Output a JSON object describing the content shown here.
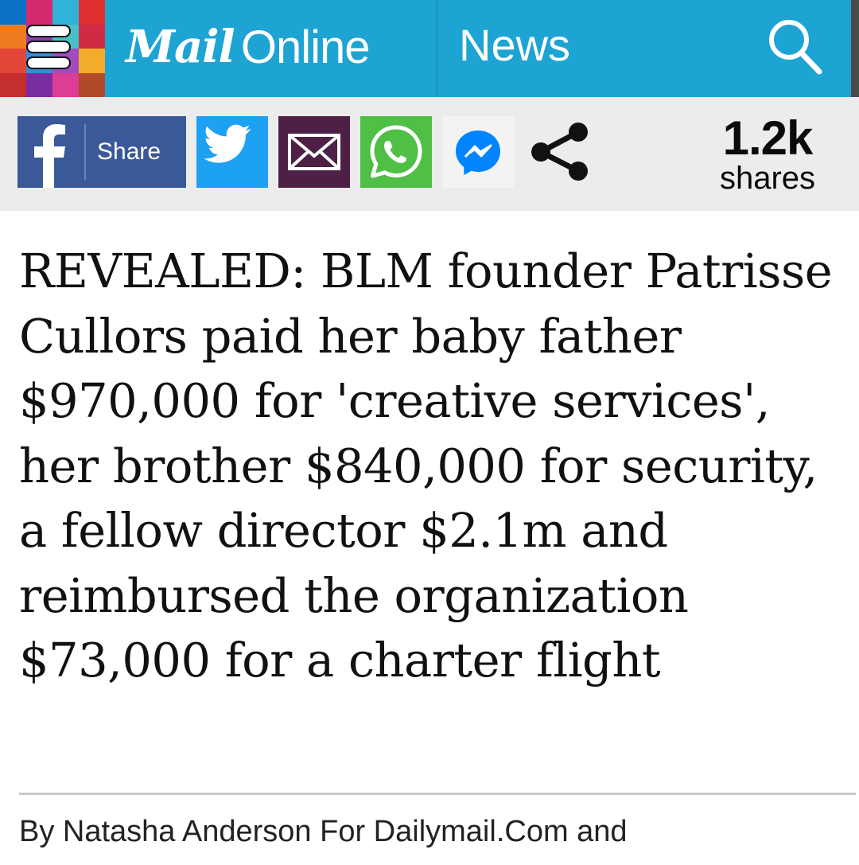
{
  "header": {
    "logo_mail": "Mail",
    "logo_online": "Online",
    "section": "News",
    "menu_icon": "hamburger-menu-icon",
    "search_icon": "search-icon",
    "bar_color": "#1ea4d2"
  },
  "share_bar": {
    "facebook_label": "Share",
    "icons": [
      "facebook-icon",
      "twitter-icon",
      "email-icon",
      "whatsapp-icon",
      "messenger-icon",
      "share-icon"
    ],
    "count": "1.2k",
    "count_label": "shares",
    "colors": {
      "facebook": "#3b5998",
      "twitter": "#1da1f2",
      "email": "#4e2046",
      "whatsapp": "#4fbf45",
      "messenger": "#0084ff"
    }
  },
  "article": {
    "headline": "REVEALED: BLM founder Patrisse Cullors paid her baby father $970,000 for 'creative services', her brother $840,000 for security, a fellow director $2.1m and reimbursed the organization $73,000 for a charter flight",
    "byline": "By Natasha Anderson For Dailymail.Com and"
  }
}
